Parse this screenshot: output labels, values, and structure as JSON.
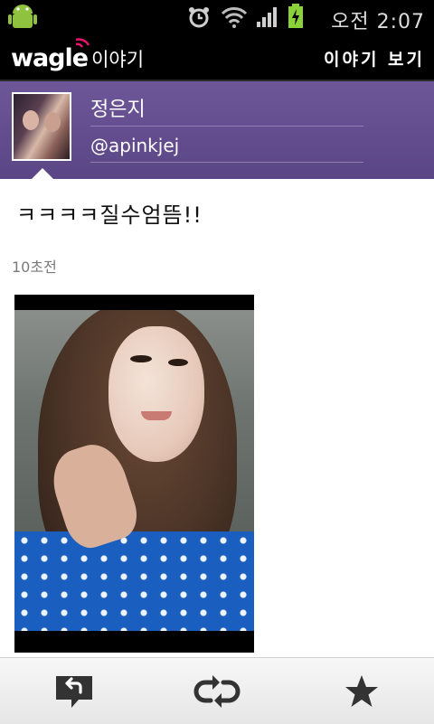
{
  "status_bar": {
    "time": "오전 2:07",
    "icons": [
      "android-icon",
      "alarm-icon",
      "wifi-icon",
      "signal-icon",
      "battery-charging-icon"
    ]
  },
  "app_bar": {
    "logo_text": "wagle",
    "logo_sub": "이야기",
    "view_link": "이야기 보기",
    "brand_accent": "#e8156c"
  },
  "profile": {
    "name": "정은지",
    "handle": "@apinkjej",
    "header_color": "#5f4a8b"
  },
  "post": {
    "text": "ㅋㅋㅋㅋ질수엄뜸!!",
    "time": "10초전"
  },
  "bottom_bar": {
    "buttons": [
      "reply-icon",
      "retweet-icon",
      "star-icon"
    ]
  }
}
